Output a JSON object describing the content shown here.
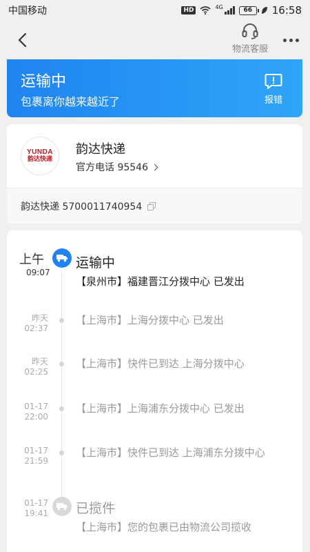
{
  "status_bar": {
    "carrier": "中国移动",
    "hd": "HD",
    "network": "4G",
    "battery": "66",
    "time": "16:58"
  },
  "header": {
    "back_icon": "chevron-left-icon",
    "customer_service_label": "物流客服",
    "more_icon": "more-dots-icon"
  },
  "banner": {
    "title": "运输中",
    "subtitle": "包裹离你越来越近了",
    "report_label": "报错",
    "color_start": "#1f84f0",
    "color_end": "#2fa5f8"
  },
  "courier": {
    "logo_en": "YUNDA",
    "logo_cn": "韵达快递",
    "name": "韵达快递",
    "phone_label": "官方电话 95546",
    "tracking_text": "韵达快递 5700011740954"
  },
  "timeline": {
    "first": {
      "date": "上午",
      "time": "09:07",
      "status": "运输中",
      "message": "【泉州市】福建晋江分拨中心 已发出"
    },
    "entries": [
      {
        "date": "昨天",
        "time": "02:37",
        "message": "【上海市】上海分拨中心 已发出"
      },
      {
        "date": "昨天",
        "time": "02:25",
        "message": "【上海市】快件已到达 上海分拨中心"
      },
      {
        "date": "01-17",
        "time": "22:00",
        "message": "【上海市】上海浦东分拨中心 已发出"
      },
      {
        "date": "01-17",
        "time": "21:59",
        "message": "【上海市】快件已到达 上海浦东分拨中心"
      }
    ],
    "pickup": {
      "date": "01-17",
      "time": "19:41",
      "status": "已揽件",
      "message": "【上海市】您的包裹已由物流公司揽收"
    },
    "accent_color": "#1f84f0"
  }
}
